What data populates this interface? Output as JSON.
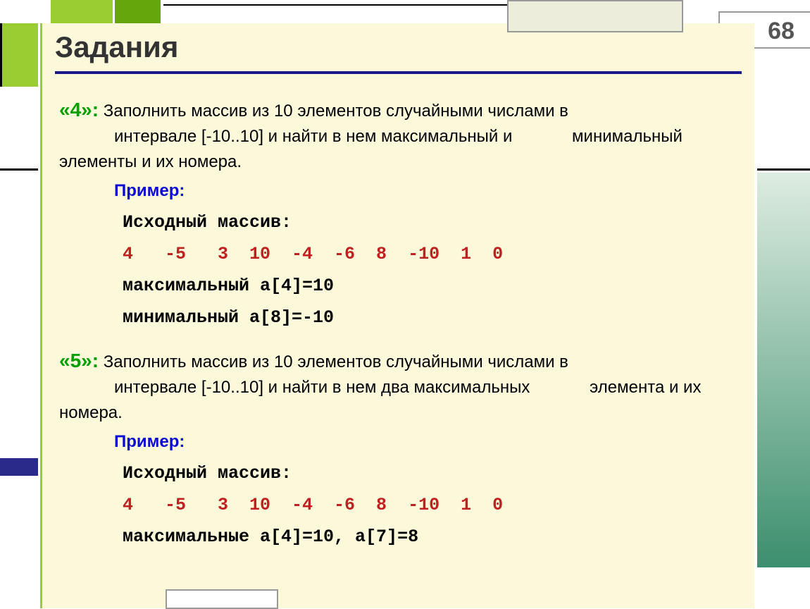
{
  "slideNumber": "68",
  "title": "Задания",
  "task4": {
    "label": "«4»:",
    "textLine1": "Заполнить массив из 10 элементов случайными числами в",
    "textLine2": "интервале [-10..10] и найти в нем максимальный и",
    "textLine3": "минимальный элементы и их номера.",
    "exampleLabel": "Пример:",
    "sourceLabel": "Исходный массив:",
    "array": "4   -5   3  10  -4  -6  8  -10  1  0",
    "maxLine": "максимальный a[4]=10",
    "minLine": "минимальный  a[8]=-10"
  },
  "task5": {
    "label": "«5»:",
    "textLine1": "Заполнить массив из 10 элементов случайными числами в",
    "textLine2": "интервале [-10..10] и найти в нем два максимальных",
    "textLine3": "элемента и их номера.",
    "exampleLabel": "Пример:",
    "sourceLabel": "Исходный массив:",
    "array": "4   -5   3  10  -4  -6  8  -10  1  0",
    "maxLine": "максимальные a[4]=10, a[7]=8"
  }
}
